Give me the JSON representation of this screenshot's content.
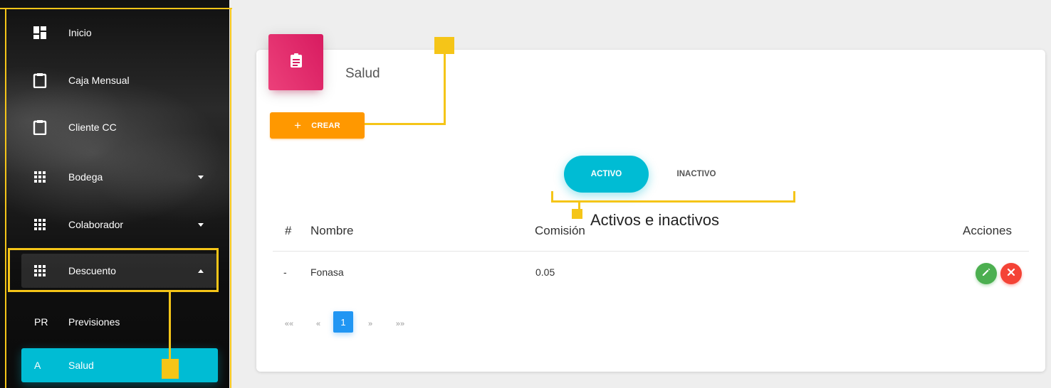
{
  "sidebar": {
    "items": [
      {
        "label": "Inicio",
        "icon": "dashboard-icon"
      },
      {
        "label": "Caja Mensual",
        "icon": "clipboard-icon"
      },
      {
        "label": "Cliente CC",
        "icon": "clipboard-icon"
      },
      {
        "label": "Bodega",
        "icon": "grid-icon"
      },
      {
        "label": "Colaborador",
        "icon": "grid-icon"
      },
      {
        "label": "Descuento",
        "icon": "grid-icon"
      }
    ],
    "subitems": [
      {
        "mini": "PR",
        "label": "Previsiones"
      },
      {
        "mini": "A",
        "label": "Salud"
      }
    ]
  },
  "card": {
    "title": "Salud",
    "icon": "assignment-icon"
  },
  "toolbar": {
    "create_label": "CREAR"
  },
  "tabs": [
    {
      "label": "ACTIVO"
    },
    {
      "label": "INACTIVO"
    }
  ],
  "annotation": {
    "tabs_note": "Activos e inactivos"
  },
  "table": {
    "headers": [
      "#",
      "Nombre",
      "Comisión",
      "Acciones"
    ],
    "rows": [
      {
        "index": "-",
        "name": "Fonasa",
        "commission": "0.05"
      }
    ]
  },
  "pagination": {
    "first": "««",
    "prev": "«",
    "current": "1",
    "next": "»",
    "last": "»»"
  },
  "colors": {
    "accent": "#00bcd4",
    "create_button": "#ff9800",
    "header_icon": "#e91e63",
    "annotation": "#f5c518",
    "edit": "#4caf50",
    "delete": "#f44336",
    "page_active": "#2196f3"
  }
}
